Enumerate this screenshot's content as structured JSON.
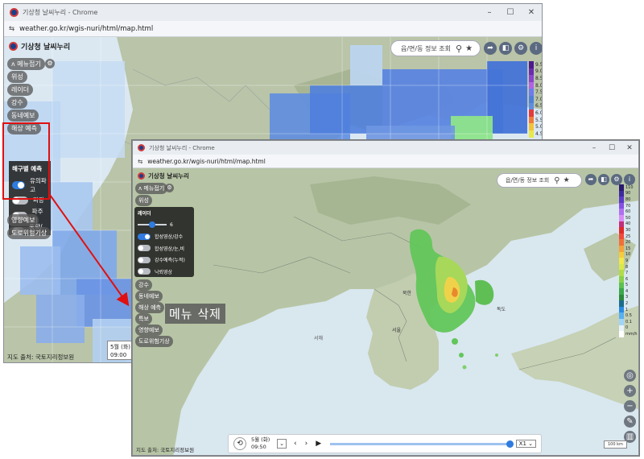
{
  "back_window": {
    "title": "기상청 날씨누리 - Chrome",
    "url": "weather.go.kr/wgis-nuri/html/map.html",
    "brand": "기상청 날씨누리",
    "search_placeholder": "읍/면/동 정보 조회",
    "menu_toggle": "메뉴접기",
    "side_menu": [
      "위성",
      "레이더",
      "강수",
      "동네예보",
      "해상 예측"
    ],
    "lower_menu": [
      "영향예보",
      "도로위험기상"
    ],
    "panel": {
      "title": "해구별 예측",
      "items": [
        {
          "label": "유의파고",
          "on": true
        },
        {
          "label": "파랑",
          "on": false
        },
        {
          "label": "파주기",
          "on": false
        },
        {
          "label": "풍향/풍속",
          "on": false
        }
      ]
    },
    "legend_labels": [
      "9.5",
      "9.0",
      "8.5",
      "8.0",
      "7.5",
      "7.0",
      "6.5",
      "6.0",
      "5.5",
      "5.0",
      "4.5"
    ],
    "credit": "지도 출처: 국토지리정보원",
    "time_date": "5월 (화)",
    "time_clock": "09:00"
  },
  "front_window": {
    "title": "기상청 날씨누리 - Chrome",
    "url": "weather.go.kr/wgis-nuri/html/map.html",
    "brand": "기상청 날씨누리",
    "search_placeholder": "읍/면/동 정보 조회",
    "menu_toggle": "메뉴접기",
    "menu_satellite": "위성",
    "panel": {
      "title": "레이더",
      "slider_value": "6",
      "items": [
        {
          "label": "합성영상/강수",
          "on": true
        },
        {
          "label": "합성영상/눈,비",
          "on": false
        },
        {
          "label": "강수예측(누적)",
          "on": false
        },
        {
          "label": "낙뢰영상",
          "on": false
        }
      ]
    },
    "lower_menu": [
      "강수",
      "동네예보",
      "해상 예측",
      "특보",
      "영향예보",
      "도로위험기상"
    ],
    "map_labels": {
      "korea_north": "북한",
      "korea_south": "서울",
      "dokdo": "독도",
      "sea_west": "서해"
    },
    "legend_labels": [
      "110",
      "90",
      "80",
      "70",
      "60",
      "50",
      "40",
      "30",
      "25",
      "20",
      "15",
      "10",
      "9",
      "8",
      "7",
      "6",
      "5",
      "4",
      "3",
      "2",
      "1",
      "0.5",
      "0.1",
      "0",
      "mm/h"
    ],
    "credit": "지도 출처: 국토지리정보원",
    "player": {
      "date": "5월 (화)",
      "time": "09:50",
      "speed": "X1"
    },
    "scale": "100 km"
  },
  "annotation": {
    "label": "메뉴 삭제",
    "color": "#e01010"
  },
  "icons": {
    "search": "search-icon",
    "star": "star-icon",
    "share": "share-icon",
    "gear": "gear-icon",
    "info": "info-icon",
    "history": "history-icon",
    "play": "play-icon"
  }
}
